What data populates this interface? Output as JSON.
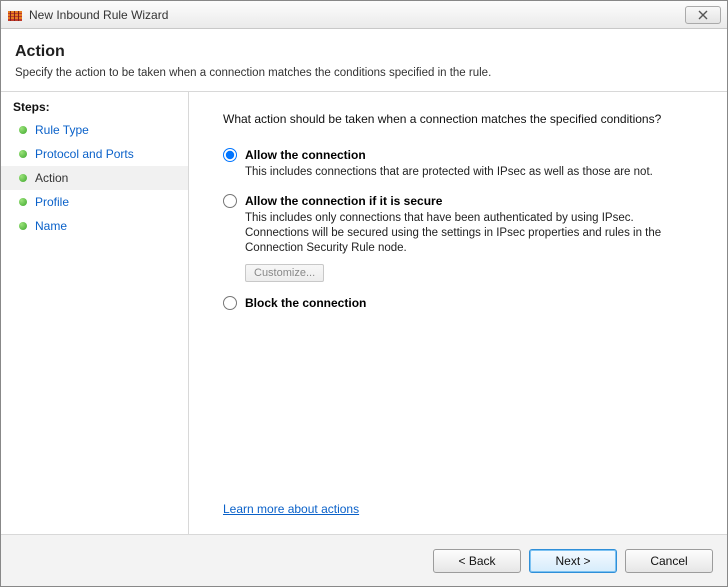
{
  "window": {
    "title": "New Inbound Rule Wizard"
  },
  "header": {
    "title": "Action",
    "subtitle": "Specify the action to be taken when a connection matches the conditions specified in the rule."
  },
  "sidebar": {
    "heading": "Steps:",
    "items": [
      {
        "label": "Rule Type",
        "current": false
      },
      {
        "label": "Protocol and Ports",
        "current": false
      },
      {
        "label": "Action",
        "current": true
      },
      {
        "label": "Profile",
        "current": false
      },
      {
        "label": "Name",
        "current": false
      }
    ]
  },
  "content": {
    "question": "What action should be taken when a connection matches the specified conditions?",
    "options": [
      {
        "id": "allow",
        "title": "Allow the connection",
        "desc": "This includes connections that are protected with IPsec as well as those are not.",
        "selected": true
      },
      {
        "id": "allow-secure",
        "title": "Allow the connection if it is secure",
        "desc": "This includes only connections that have been authenticated by using IPsec.  Connections will be secured using the settings in IPsec properties and rules in the Connection Security Rule node.",
        "selected": false,
        "customize_label": "Customize..."
      },
      {
        "id": "block",
        "title": "Block the connection",
        "desc": "",
        "selected": false
      }
    ],
    "learn_more": "Learn more about actions"
  },
  "footer": {
    "back": "< Back",
    "next": "Next >",
    "cancel": "Cancel"
  }
}
